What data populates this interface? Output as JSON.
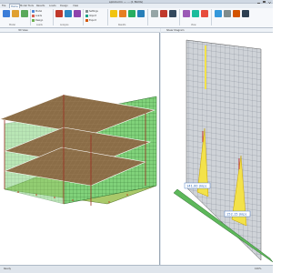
{
  "window": {
    "title": "spColumn — ... (1 BLDG)",
    "controls": [
      "minimize",
      "maximize",
      "close"
    ]
  },
  "ribbon": {
    "tabs": [
      "File",
      "Home",
      "Model Tools",
      "Results",
      "Loads",
      "Design",
      "View"
    ],
    "active_tab_index": 1,
    "small_commands": [
      "Model",
      "Loads",
      "Design",
      "Settings",
      "Import",
      "Export"
    ],
    "group_labels": [
      "Model",
      "Loads",
      "Analysis",
      "Results",
      "View"
    ]
  },
  "left_view": {
    "title": "3D View",
    "colors": {
      "slab": "#8b6d47",
      "slab_edge": "#ffffff",
      "wall": "#80d27a",
      "wall_grid": "#2e6b2f",
      "base": "#a9c96a"
    }
  },
  "right_view": {
    "title": "Shear Diagram",
    "labels": [
      "141.00 (kip)",
      "152.15 (kip)"
    ],
    "colors": {
      "mesh": "#cfd3d8",
      "mesh_line": "#6b7280",
      "diagram": "#f3e24a",
      "diagram_edge": "#c9a300",
      "base": "#5db85a"
    }
  },
  "status": {
    "left": "Ready",
    "right": "100%"
  }
}
